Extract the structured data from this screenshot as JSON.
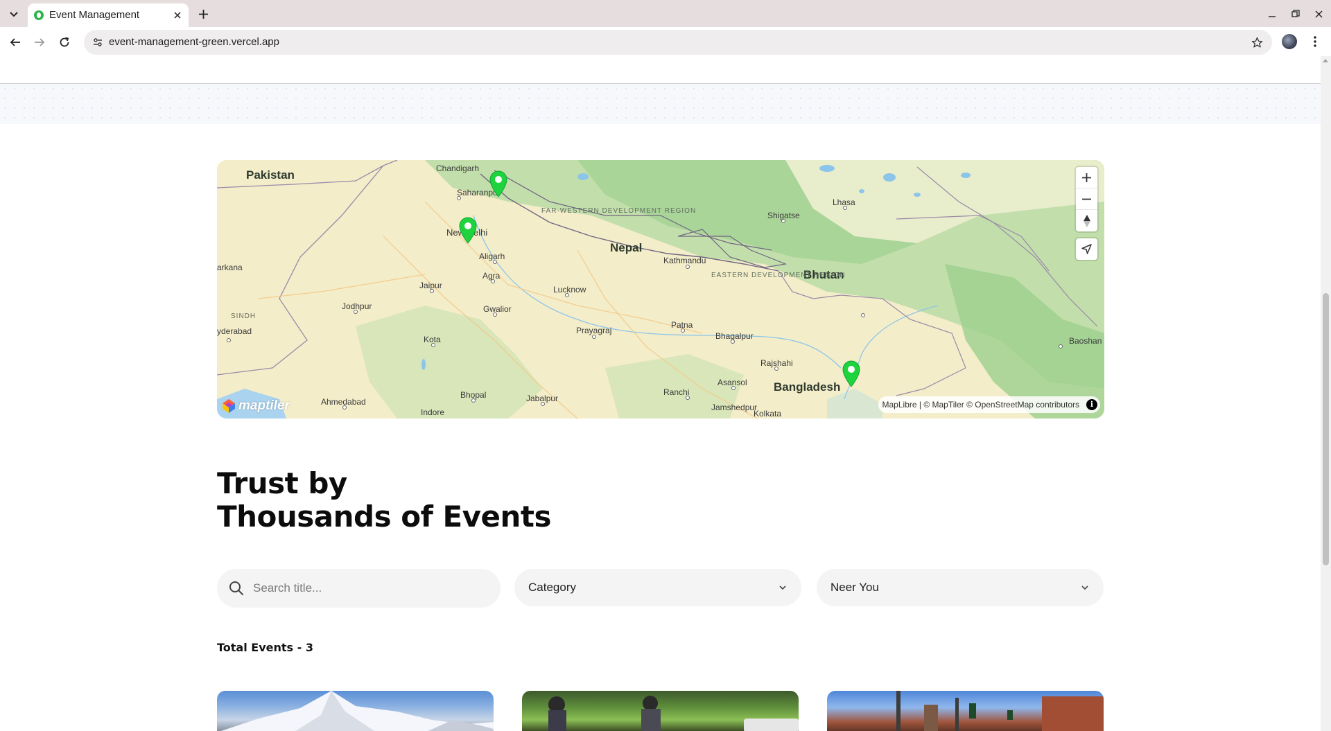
{
  "browser": {
    "tab_title": "Event Management",
    "url": "event-management-green.vercel.app"
  },
  "map": {
    "countries": [
      "Pakistan",
      "Nepal",
      "Bhutan",
      "Bangladesh"
    ],
    "regions": [
      "FAR-WESTERN DEVELOPMENT REGION",
      "EASTERN DEVELOPMENT REGION"
    ],
    "areas": [
      "SINDH"
    ],
    "cities": [
      "Chandigarh",
      "Saharanpur",
      "New Delhi",
      "Aligarh",
      "Agra",
      "Jaipur",
      "Jodhpur",
      "Gwalior",
      "Lucknow",
      "Kathmandu",
      "Shigatse",
      "Lhasa",
      "Prayagraj",
      "Patna",
      "Bhagalpur",
      "Kota",
      "Rajshahi",
      "Asansol",
      "Ranchi",
      "Jamshedpur",
      "Kolkata",
      "Bhopal",
      "Jabalpur",
      "Ahmedabad",
      "Indore",
      "Baoshan",
      "arkana",
      "yderabad"
    ],
    "markers": [
      "event-marker-saharanpur",
      "event-marker-new-delhi",
      "event-marker-bangladesh"
    ],
    "controls": [
      "zoom-in",
      "zoom-out",
      "reset-north",
      "geolocate"
    ],
    "logo_text": "maptiler",
    "attribution": "MapLibre | © MapTiler © OpenStreetMap contributors",
    "pin_color": "#22c55e"
  },
  "section": {
    "title_line1": "Trust by",
    "title_line2": "Thousands of Events"
  },
  "filters": {
    "search_placeholder": "Search title...",
    "category_label": "Category",
    "location_label": "Neer You"
  },
  "events": {
    "total_label": "Total Events - 3",
    "cards": [
      {
        "image": "snowy-mountain-peaks"
      },
      {
        "image": "volunteers-planting"
      },
      {
        "image": "city-street-traffic-lights"
      }
    ]
  }
}
